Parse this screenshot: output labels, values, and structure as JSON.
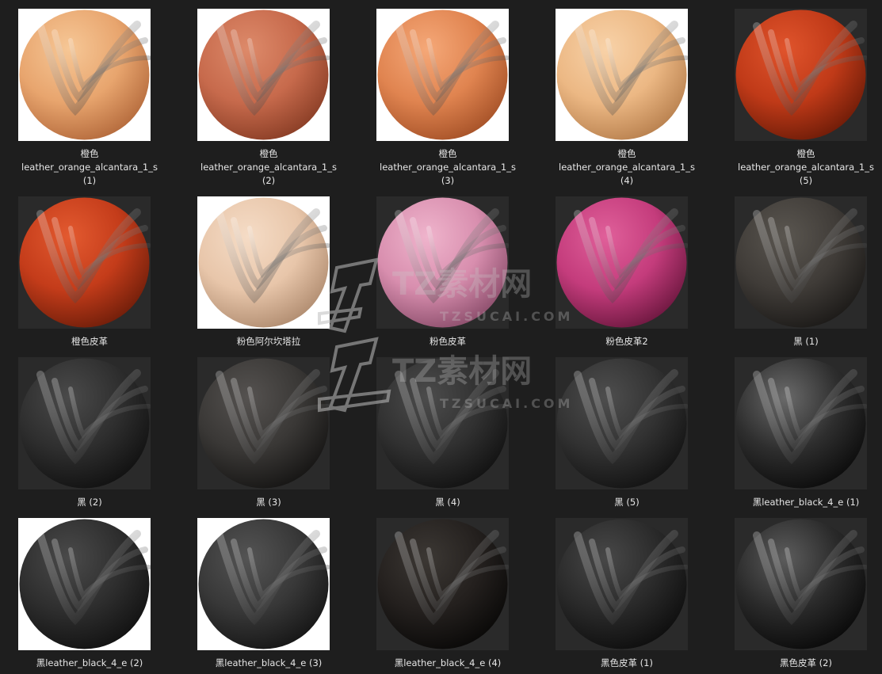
{
  "watermark": {
    "brand": "TZ素材网",
    "domain": "TZSUCAI.COM"
  },
  "items": [
    {
      "lines": [
        "橙色",
        "leather_orange_alcantara_1_s",
        "(1)"
      ],
      "bg": "light",
      "c1": "#f6c796",
      "c2": "#e8a56e",
      "c3": "#b46a3c"
    },
    {
      "lines": [
        "橙色",
        "leather_orange_alcantara_1_s",
        "(2)"
      ],
      "bg": "light",
      "c1": "#dd8a6a",
      "c2": "#c76a4c",
      "c3": "#8a3e26"
    },
    {
      "lines": [
        "橙色",
        "leather_orange_alcantara_1_s",
        "(3)"
      ],
      "bg": "light",
      "c1": "#f5a878",
      "c2": "#e08450",
      "c3": "#a65228"
    },
    {
      "lines": [
        "橙色",
        "leather_orange_alcantara_1_s",
        "(4)"
      ],
      "bg": "light",
      "c1": "#f8d2a8",
      "c2": "#ecb884",
      "c3": "#b8804e"
    },
    {
      "lines": [
        "橙色",
        "leather_orange_alcantara_1_s",
        "(5)"
      ],
      "bg": "dark",
      "c1": "#e0542c",
      "c2": "#c03a18",
      "c3": "#6e1c08"
    },
    {
      "lines": [
        "橙色皮革"
      ],
      "bg": "dark",
      "c1": "#e35a30",
      "c2": "#c43c1a",
      "c3": "#701e0a"
    },
    {
      "lines": [
        "粉色阿尔坎塔拉"
      ],
      "bg": "light",
      "c1": "#f5dcc6",
      "c2": "#e8c6aa",
      "c3": "#b08c70"
    },
    {
      "lines": [
        "粉色皮革"
      ],
      "bg": "dark",
      "c1": "#efb4cc",
      "c2": "#d88eae",
      "c3": "#8c4e6c"
    },
    {
      "lines": [
        "粉色皮革2"
      ],
      "bg": "dark",
      "c1": "#e0609a",
      "c2": "#c43c7c",
      "c3": "#6e1840"
    },
    {
      "lines": [
        "黑 (1)"
      ],
      "bg": "dark",
      "c1": "#5a5650",
      "c2": "#403c38",
      "c3": "#1c1a18"
    },
    {
      "lines": [
        "黑 (2)"
      ],
      "bg": "dark",
      "c1": "#4a4a4a",
      "c2": "#2e2e2e",
      "c3": "#111111"
    },
    {
      "lines": [
        "黑 (3)"
      ],
      "bg": "dark",
      "c1": "#555250",
      "c2": "#3a3836",
      "c3": "#161514"
    },
    {
      "lines": [
        "黑 (4)"
      ],
      "bg": "dark",
      "c1": "#4c4c4c",
      "c2": "#313131",
      "c3": "#121212"
    },
    {
      "lines": [
        "黑 (5)"
      ],
      "bg": "dark",
      "c1": "#4e4e4e",
      "c2": "#323232",
      "c3": "#131313"
    },
    {
      "lines": [
        "黑leather_black_4_e (1)"
      ],
      "bg": "dark",
      "c1": "#6a6a6a",
      "c2": "#2e2e2e",
      "c3": "#0c0c0c"
    },
    {
      "lines": [
        "黑leather_black_4_e (2)"
      ],
      "bg": "light",
      "c1": "#4a4a4a",
      "c2": "#2e2e2e",
      "c3": "#121212"
    },
    {
      "lines": [
        "黑leather_black_4_e (3)"
      ],
      "bg": "light",
      "c1": "#545454",
      "c2": "#383838",
      "c3": "#161616"
    },
    {
      "lines": [
        "黑leather_black_4_e (4)"
      ],
      "bg": "dark",
      "c1": "#3c3834",
      "c2": "#24201e",
      "c3": "#0a0908"
    },
    {
      "lines": [
        "黑色皮革 (1)"
      ],
      "bg": "dark",
      "c1": "#484848",
      "c2": "#2a2a2a",
      "c3": "#0e0e0e"
    },
    {
      "lines": [
        "黑色皮革 (2)"
      ],
      "bg": "dark",
      "c1": "#5c5c5c",
      "c2": "#2a2a2a",
      "c3": "#0a0a0a"
    }
  ]
}
